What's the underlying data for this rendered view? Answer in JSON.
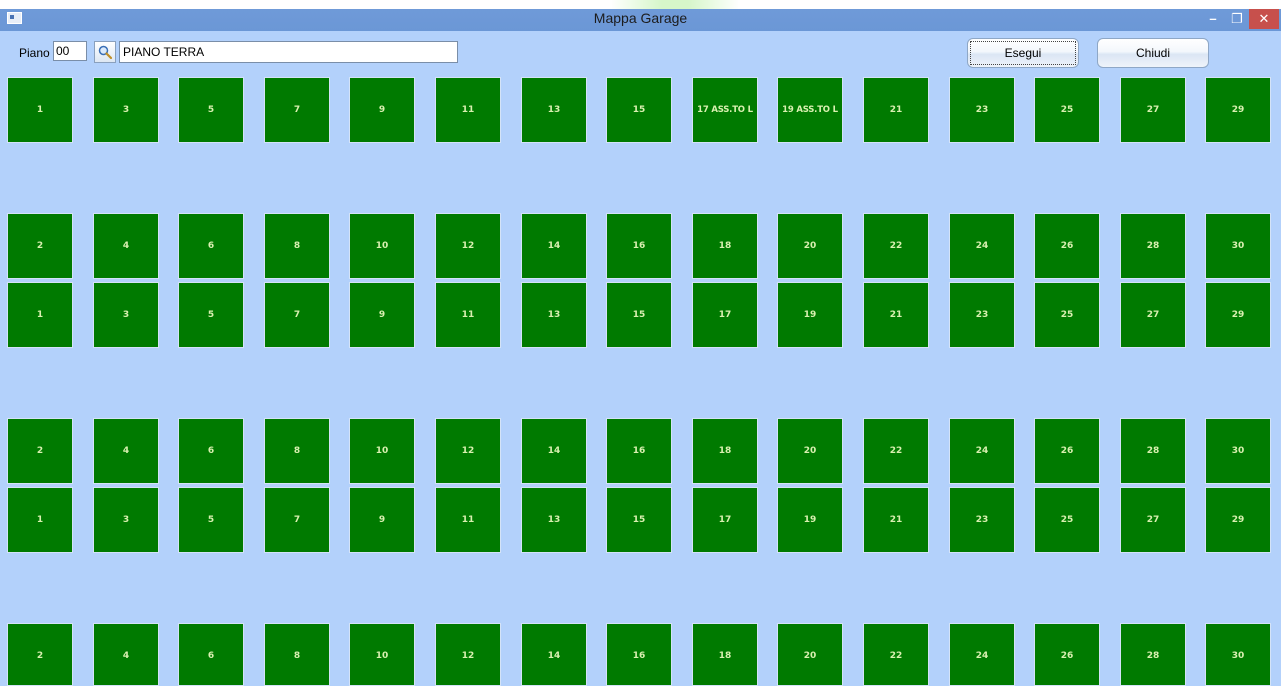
{
  "window": {
    "title": "Mappa Garage",
    "minimize": "–",
    "maximize": "❐",
    "close": "✕"
  },
  "toolbar": {
    "floor_label": "Piano",
    "floor_code": "00",
    "floor_name": "PIANO TERRA",
    "execute_label": "Esegui",
    "close_label": "Chiudi"
  },
  "colors": {
    "spot_free": "#007a00",
    "background": "#b3d1fb",
    "titlebar": "#6b97d6"
  },
  "spot_rows": [
    [
      "1",
      "3",
      "5",
      "7",
      "9",
      "11",
      "13",
      "15",
      "17 ASS.TO L",
      "19 ASS.TO L",
      "21",
      "23",
      "25",
      "27",
      "29"
    ],
    [
      "2",
      "4",
      "6",
      "8",
      "10",
      "12",
      "14",
      "16",
      "18",
      "20",
      "22",
      "24",
      "26",
      "28",
      "30"
    ],
    [
      "1",
      "3",
      "5",
      "7",
      "9",
      "11",
      "13",
      "15",
      "17",
      "19",
      "21",
      "23",
      "25",
      "27",
      "29"
    ],
    [
      "2",
      "4",
      "6",
      "8",
      "10",
      "12",
      "14",
      "16",
      "18",
      "20",
      "22",
      "24",
      "26",
      "28",
      "30"
    ],
    [
      "1",
      "3",
      "5",
      "7",
      "9",
      "11",
      "13",
      "15",
      "17",
      "19",
      "21",
      "23",
      "25",
      "27",
      "29"
    ],
    [
      "2",
      "4",
      "6",
      "8",
      "10",
      "12",
      "14",
      "16",
      "18",
      "20",
      "22",
      "24",
      "26",
      "28",
      "30"
    ]
  ]
}
